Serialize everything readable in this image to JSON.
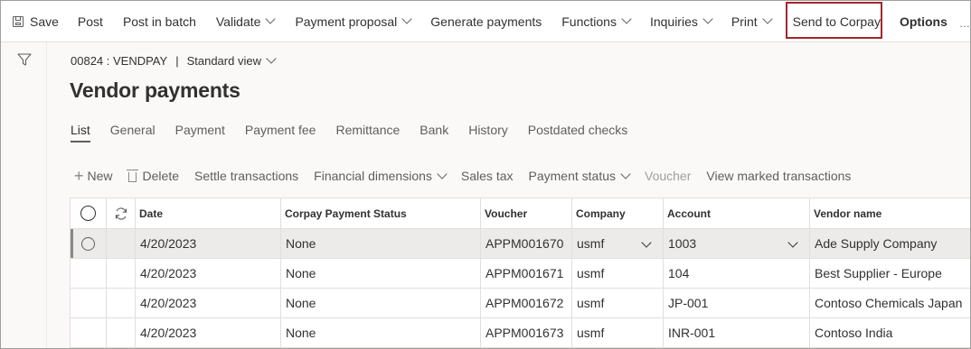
{
  "action_pane": {
    "save": "Save",
    "post": "Post",
    "post_in_batch": "Post in batch",
    "validate": "Validate",
    "payment_proposal": "Payment proposal",
    "generate_payments": "Generate payments",
    "functions": "Functions",
    "inquiries": "Inquiries",
    "print": "Print",
    "send_to_corpay": "Send to Corpay",
    "options": "Options"
  },
  "header": {
    "journal": "00824 : VENDPAY",
    "separator": "|",
    "view": "Standard view",
    "title": "Vendor payments"
  },
  "tabs": [
    "List",
    "General",
    "Payment",
    "Payment fee",
    "Remittance",
    "Bank",
    "History",
    "Postdated checks"
  ],
  "grid_toolbar": {
    "new": "New",
    "delete": "Delete",
    "settle_transactions": "Settle transactions",
    "financial_dimensions": "Financial dimensions",
    "sales_tax": "Sales tax",
    "payment_status": "Payment status",
    "voucher": "Voucher",
    "view_marked_transactions": "View marked transactions"
  },
  "grid": {
    "columns": {
      "date": "Date",
      "corpay_status": "Corpay Payment Status",
      "voucher": "Voucher",
      "company": "Company",
      "account": "Account",
      "vendor_name": "Vendor name"
    },
    "rows": [
      {
        "date": "4/20/2023",
        "status": "None",
        "voucher": "APPM001670",
        "company": "usmf",
        "account": "1003",
        "vendor": "Ade Supply Company"
      },
      {
        "date": "4/20/2023",
        "status": "None",
        "voucher": "APPM001671",
        "company": "usmf",
        "account": "104",
        "vendor": "Best Supplier - Europe"
      },
      {
        "date": "4/20/2023",
        "status": "None",
        "voucher": "APPM001672",
        "company": "usmf",
        "account": "JP-001",
        "vendor": "Contoso Chemicals Japan"
      },
      {
        "date": "4/20/2023",
        "status": "None",
        "voucher": "APPM001673",
        "company": "usmf",
        "account": "INR-001",
        "vendor": "Contoso India"
      }
    ]
  },
  "colors": {
    "highlight": "#a4262c",
    "selected_row": "#edebe9",
    "text": "#323130"
  },
  "icons": [
    "save-icon",
    "chevron-down-icon",
    "filter-icon",
    "plus-icon",
    "delete-icon",
    "refresh-icon",
    "radio-icon"
  ]
}
